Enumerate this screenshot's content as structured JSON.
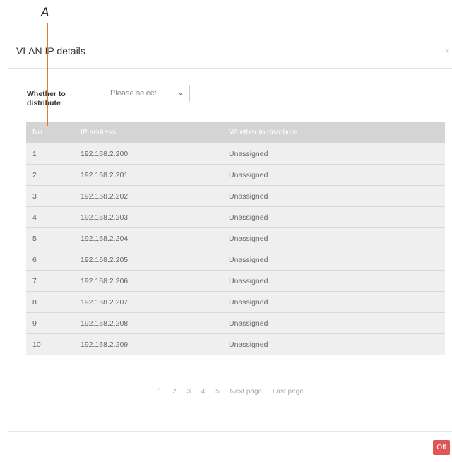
{
  "callout": {
    "label": "A"
  },
  "dialog": {
    "title": "VLAN IP details",
    "close_label": "×",
    "filter": {
      "label": "Whether to distribute",
      "placeholder": "Please select"
    },
    "table": {
      "columns": [
        "No",
        "IP address",
        "Whether to distribute"
      ],
      "rows": [
        [
          "1",
          "192.168.2.200",
          "Unassigned"
        ],
        [
          "2",
          "192.168.2.201",
          "Unassigned"
        ],
        [
          "3",
          "192.168.2.202",
          "Unassigned"
        ],
        [
          "4",
          "192.168.2.203",
          "Unassigned"
        ],
        [
          "5",
          "192.168.2.204",
          "Unassigned"
        ],
        [
          "6",
          "192.168.2.205",
          "Unassigned"
        ],
        [
          "7",
          "192.168.2.206",
          "Unassigned"
        ],
        [
          "8",
          "192.168.2.207",
          "Unassigned"
        ],
        [
          "9",
          "192.168.2.208",
          "Unassigned"
        ],
        [
          "10",
          "192.168.2.209",
          "Unassigned"
        ]
      ]
    },
    "pagination": {
      "pages": [
        "1",
        "2",
        "3",
        "4",
        "5"
      ],
      "current": "1",
      "next_label": "Next page",
      "last_label": "Last page"
    },
    "footer": {
      "off_label": "Off"
    }
  },
  "colors": {
    "header_bg": "#d4d4d4",
    "row_bg": "#efefef",
    "off_button": "#e05555",
    "callout_line": "#e07a2e"
  }
}
